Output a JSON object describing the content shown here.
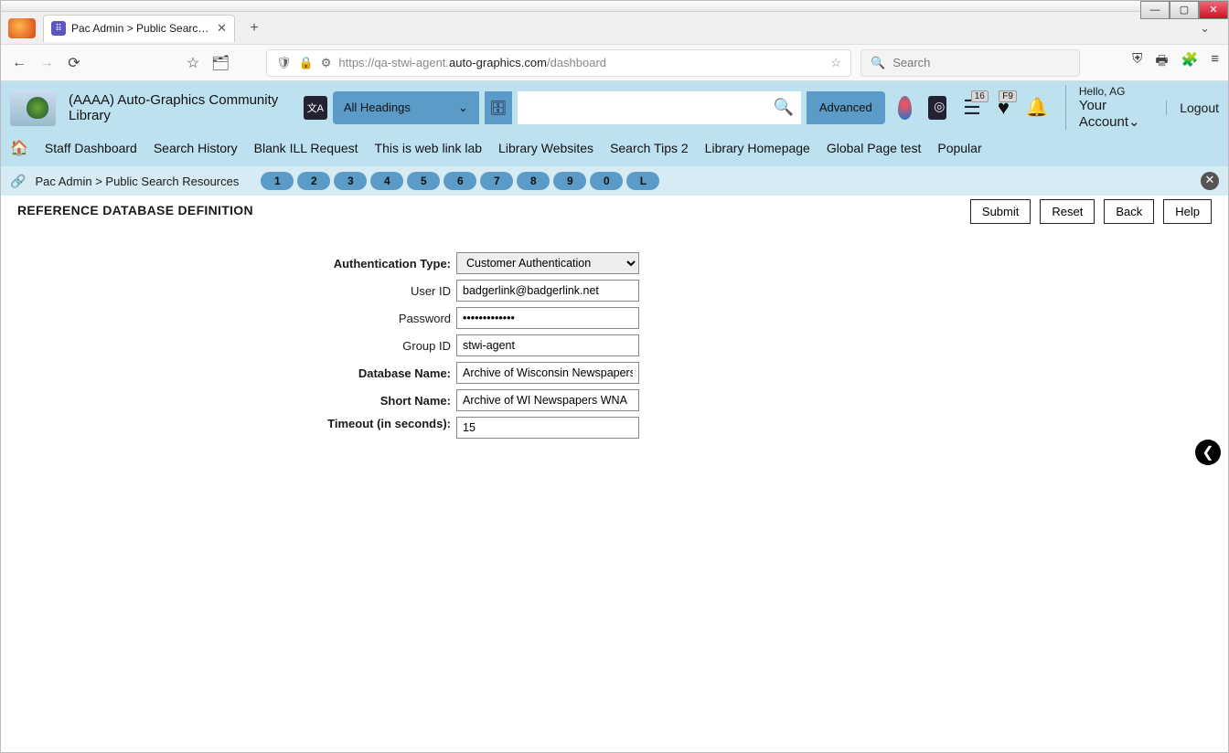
{
  "browser": {
    "tab_title": "Pac Admin > Public Search Res",
    "url_prefix": "https://qa-stwi-agent.",
    "url_host": "auto-graphics.com",
    "url_path": "/dashboard",
    "search_placeholder": "Search"
  },
  "header": {
    "library_name": "(AAAA) Auto-Graphics Community Library",
    "headings_label": "All Headings",
    "advanced_label": "Advanced",
    "badge_list": "16",
    "badge_heart": "F9",
    "hello_label": "Hello, AG",
    "account_label": "Your Account",
    "logout_label": "Logout"
  },
  "nav": {
    "items": [
      "Staff Dashboard",
      "Search History",
      "Blank ILL Request",
      "This is web link lab",
      "Library Websites",
      "Search Tips 2",
      "Library Homepage",
      "Global Page test",
      "Popular"
    ]
  },
  "breadcrumb": {
    "text": "Pac Admin > Public Search Resources",
    "pages": [
      "1",
      "2",
      "3",
      "4",
      "5",
      "6",
      "7",
      "8",
      "9",
      "0",
      "L"
    ]
  },
  "page": {
    "title": "REFERENCE DATABASE DEFINITION",
    "buttons": {
      "submit": "Submit",
      "reset": "Reset",
      "back": "Back",
      "help": "Help"
    }
  },
  "form": {
    "auth_type_label": "Authentication Type:",
    "auth_type_value": "Customer Authentication",
    "user_id_label": "User ID",
    "user_id_value": "badgerlink@badgerlink.net",
    "password_label": "Password",
    "password_value": "•••••••••••••",
    "group_id_label": "Group ID",
    "group_id_value": "stwi-agent",
    "db_name_label": "Database Name:",
    "db_name_value": "Archive of Wisconsin Newspapers",
    "short_name_label": "Short Name:",
    "short_name_value": "Archive of WI Newspapers WNA",
    "timeout_label": "Timeout (in seconds):",
    "timeout_value": "15"
  }
}
